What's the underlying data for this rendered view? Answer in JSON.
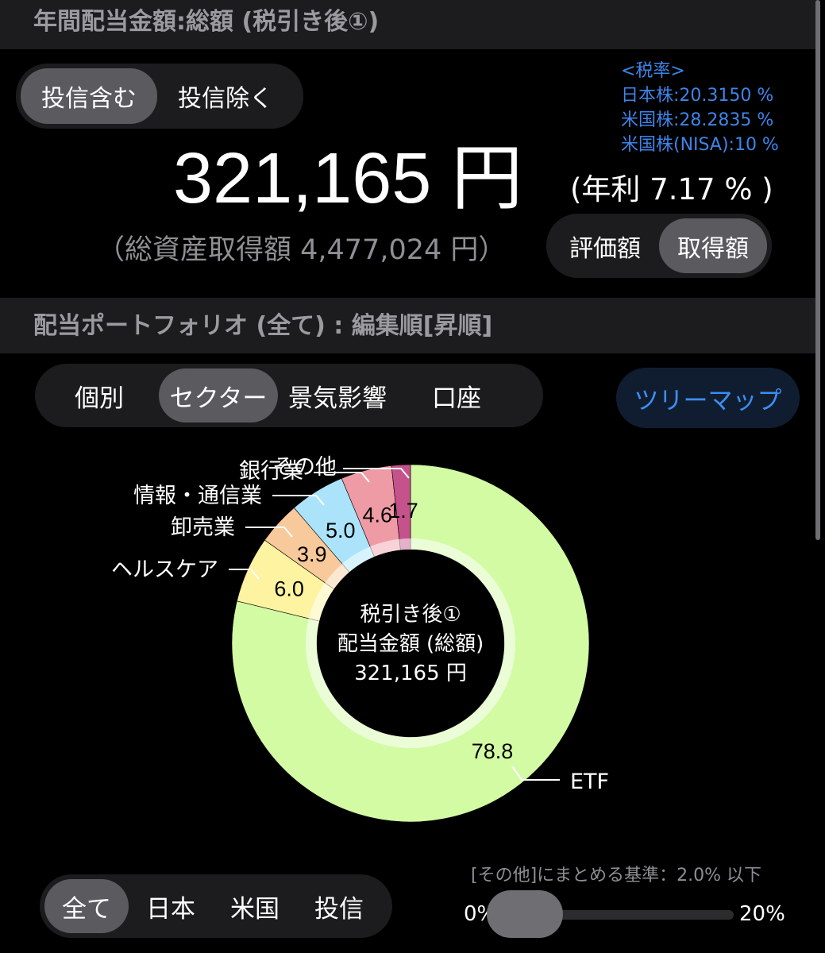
{
  "header": {
    "title": "年間配当金額:総額 (税引き後①)"
  },
  "toushin_toggle": {
    "options": [
      "投信含む",
      "投信除く"
    ],
    "selected": 0
  },
  "tax": {
    "heading": "<税率>",
    "lines": [
      "日本株:20.3150 %",
      "米国株:28.2835 %",
      "米国株(NISA):10 %"
    ]
  },
  "summary": {
    "total": "321,165 円",
    "yield": "(年利 7.17 % )",
    "cost": "（総資産取得額 4,477,024 円）"
  },
  "basis_toggle": {
    "options": [
      "評価額",
      "取得額"
    ],
    "selected": 1
  },
  "portfolio_header": {
    "title": "配当ポートフォリオ (全て) : 編集順[昇順]"
  },
  "group_tabs": {
    "options": [
      "個別",
      "セクター",
      "景気影響",
      "口座"
    ],
    "selected": 1
  },
  "treemap_button": "ツリーマップ",
  "chart_data": {
    "type": "pie",
    "donut": true,
    "categories": [
      "ETF",
      "ヘルスケア",
      "卸売業",
      "情報・通信業",
      "銀行業",
      "その他"
    ],
    "values": [
      78.8,
      6.0,
      3.9,
      5.0,
      4.6,
      1.7
    ],
    "labels": [
      "78.8",
      "6.0",
      "3.9",
      "5.0",
      "4.6",
      "1.7"
    ],
    "colors": [
      "#d3fba4",
      "#fdf3a1",
      "#f8c99b",
      "#abe4fa",
      "#ef9ba5",
      "#c4528b"
    ],
    "center_lines": [
      "税引き後①",
      "配当金額 (総額)",
      "321,165 円"
    ]
  },
  "region_tabs": {
    "options": [
      "全て",
      "日本",
      "米国",
      "投信"
    ],
    "selected": 0
  },
  "slider": {
    "caption": "[その他]にまとめる基準：2.0% 以下",
    "min_label": "0%",
    "max_label": "20%",
    "value": 0.1
  }
}
